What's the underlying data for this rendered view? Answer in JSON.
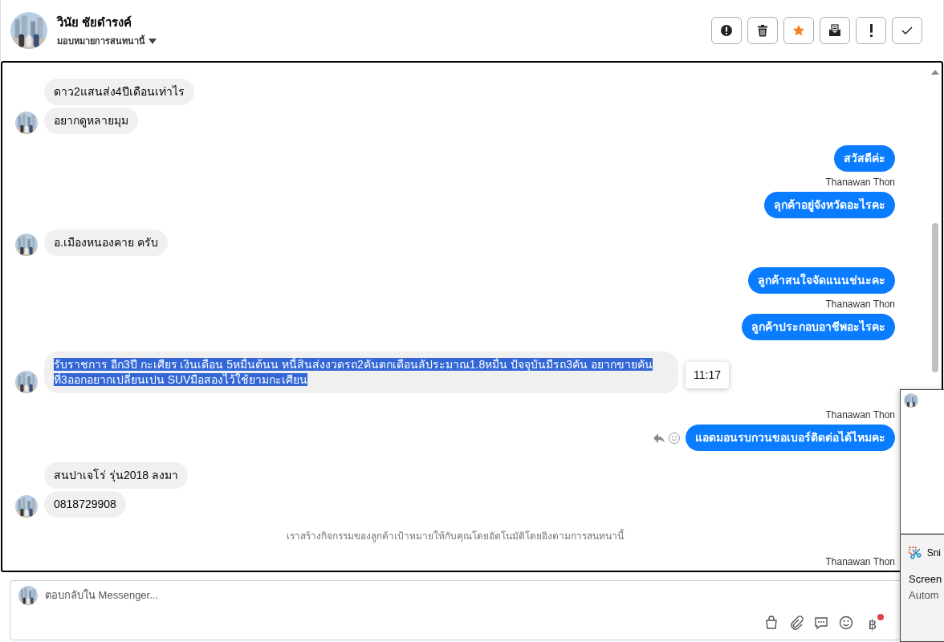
{
  "header": {
    "contact_name": "วินัย ชัยดำรงค์",
    "assign_label": "มอบหมายการสนทนานี้",
    "actions": [
      {
        "kind": "alert",
        "on": false
      },
      {
        "kind": "trash",
        "on": false
      },
      {
        "kind": "star",
        "on": true
      },
      {
        "kind": "mail",
        "on": false
      },
      {
        "kind": "important",
        "on": false
      },
      {
        "kind": "done",
        "on": false
      }
    ]
  },
  "messages": [
    {
      "kind": "incoming",
      "text": "ดาว2แสนส่ง4ปีเดือนเท่าไร",
      "highlighted": false
    },
    {
      "kind": "incoming",
      "text": "อยากดูหลายมุม",
      "highlighted": false
    },
    {
      "kind": "outgoing",
      "text": "สวัสดีค่ะ",
      "highlighted": false,
      "hover": false
    },
    {
      "kind": "sender",
      "text": "Thanawan Thon"
    },
    {
      "kind": "outgoing",
      "text": "ลุกค้าอยู่จังหวัดอะไรคะ",
      "highlighted": false,
      "hover": false
    },
    {
      "kind": "incoming",
      "text": "อ.เมืองหนองคาย ครับ",
      "highlighted": false
    },
    {
      "kind": "outgoing",
      "text": "ลูกค้าสนใจจัดแนนช่นะคะ",
      "highlighted": false,
      "hover": false
    },
    {
      "kind": "sender",
      "text": "Thanawan Thon"
    },
    {
      "kind": "outgoing",
      "text": "ลูกค้าประกอบอาชีพอะไรคะ",
      "highlighted": false,
      "hover": false
    },
    {
      "kind": "incoming",
      "text": "รับราชการ อีก3ปี กะเศียร เงินเดือน 5หมื่นต้นน หนี้สินส่งงวดรถ2คันตกเดือนลัประมาณ1.8หมื่น ปัจจุบันมีรถ3คัน อยากขายคันที่3ออกอยากเปลี่ยนเปน SUVมือสองไว้ใช้ยามกะเศียน",
      "highlighted": true
    },
    {
      "kind": "sender",
      "text": "Thanawan Thon"
    },
    {
      "kind": "outgoing",
      "text": "แอดมอนรบกวนขอเบอร์ติดต่อได้ไหมคะ",
      "highlighted": false,
      "hover": true,
      "time": "11:17"
    },
    {
      "kind": "incoming",
      "text": "สนปาเจโร่ รุ่น2018 ลงมา",
      "highlighted": false
    },
    {
      "kind": "incoming",
      "text": "0818729908",
      "highlighted": false
    },
    {
      "kind": "notice",
      "text": "เราสร้างกิจกรรมของลูกค้าเป้าหมายให้กับคุณโดยอัตโนมัติโดยอิงตามการสนทนานี้"
    },
    {
      "kind": "sender",
      "text": "Thanawan Thon"
    }
  ],
  "notification": {
    "app": "Sni",
    "title": "Screen",
    "body": "Autom"
  },
  "composer": {
    "placeholder": "ตอบกลับใน Messenger...",
    "tools": [
      {
        "kind": "bag",
        "badge": false
      },
      {
        "kind": "clip",
        "badge": false
      },
      {
        "kind": "chat",
        "badge": false
      },
      {
        "kind": "smile",
        "badge": false
      },
      {
        "kind": "baht",
        "text": "฿",
        "badge": true
      }
    ]
  }
}
